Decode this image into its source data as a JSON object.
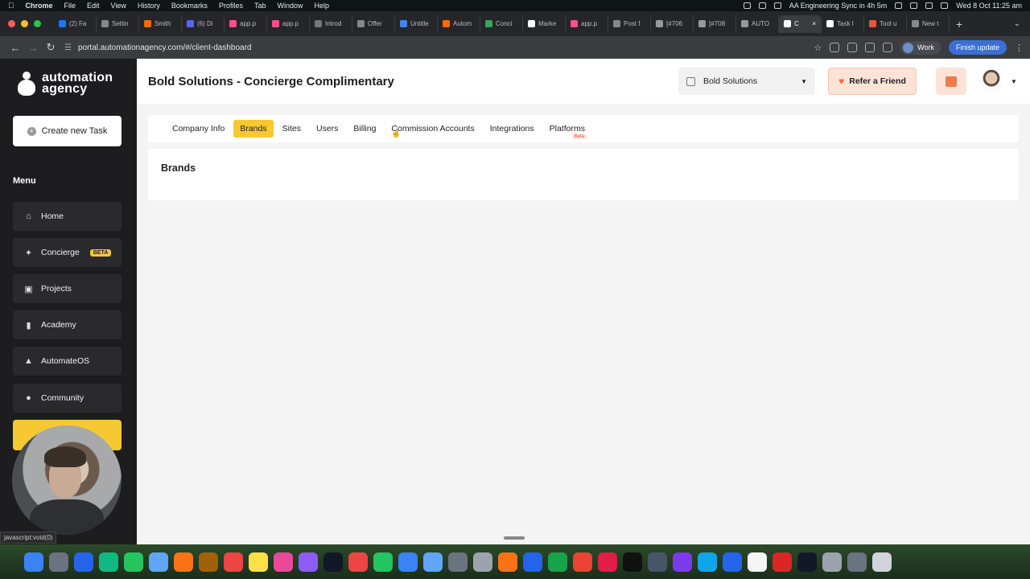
{
  "os_menubar": {
    "app": "Chrome",
    "items": [
      "File",
      "Edit",
      "View",
      "History",
      "Bookmarks",
      "Profiles",
      "Tab",
      "Window",
      "Help"
    ],
    "sync_status": "AA Engineering Sync in 4h 5m",
    "datetime": "Wed 8 Oct  11:25 am"
  },
  "browser": {
    "tabs": [
      {
        "label": "(2) Fa",
        "color": "#1877f2"
      },
      {
        "label": "Settin",
        "color": "#888888"
      },
      {
        "label": "Smith",
        "color": "#ff6a00"
      },
      {
        "label": "(6) Di",
        "color": "#5865f2"
      },
      {
        "label": "app.p",
        "color": "#ff4f8b"
      },
      {
        "label": "app.p",
        "color": "#ff4f8b"
      },
      {
        "label": "Introd",
        "color": "#777777"
      },
      {
        "label": "Offer",
        "color": "#888888"
      },
      {
        "label": "Untitle",
        "color": "#4285f4"
      },
      {
        "label": "Autom",
        "color": "#ff6a00"
      },
      {
        "label": "Conci",
        "color": "#34a853"
      },
      {
        "label": "Marke",
        "color": "#ffffff"
      },
      {
        "label": "app.p",
        "color": "#ff4f8b"
      },
      {
        "label": "Post f",
        "color": "#888888"
      },
      {
        "label": "[#706",
        "color": "#999999"
      },
      {
        "label": "[#708",
        "color": "#999999"
      },
      {
        "label": "AUTO",
        "color": "#999999"
      },
      {
        "label": "C",
        "color": "#ffffff",
        "active": true
      },
      {
        "label": "Task I",
        "color": "#ffffff"
      },
      {
        "label": "Tool u",
        "color": "#e8553d"
      },
      {
        "label": "New t",
        "color": "#888888"
      }
    ],
    "url": "portal.automationagency.com/#/client-dashboard",
    "profile_label": "Work",
    "update_button": "Finish update",
    "status_url": "javascript:void(0)"
  },
  "sidebar": {
    "logo_line1": "automation",
    "logo_line2": "agency",
    "create_button": "Create new Task",
    "menu_header": "Menu",
    "items": [
      {
        "label": "Home",
        "icon": "home-icon"
      },
      {
        "label": "Concierge",
        "icon": "sparkle-icon",
        "badge": "BETA"
      },
      {
        "label": "Projects",
        "icon": "projects-icon"
      },
      {
        "label": "Academy",
        "icon": "book-icon"
      },
      {
        "label": "AutomateOS",
        "icon": "network-icon"
      },
      {
        "label": "Community",
        "icon": "people-icon"
      }
    ]
  },
  "header": {
    "title": "Bold Solutions - Concierge Complimentary",
    "company_select": "Bold Solutions",
    "refer_button": "Refer a Friend"
  },
  "section_tabs": [
    {
      "label": "Company Info"
    },
    {
      "label": "Brands",
      "active": true
    },
    {
      "label": "Sites"
    },
    {
      "label": "Users"
    },
    {
      "label": "Billing"
    },
    {
      "label": "Commission Accounts"
    },
    {
      "label": "Integrations"
    },
    {
      "label": "Platforms",
      "badge": "Beta"
    }
  ],
  "content": {
    "section_title": "Brands"
  },
  "colors": {
    "accent_yellow": "#f6c933",
    "refer_bg": "#fde3d7",
    "sidebar_bg": "#1d1d1f"
  }
}
